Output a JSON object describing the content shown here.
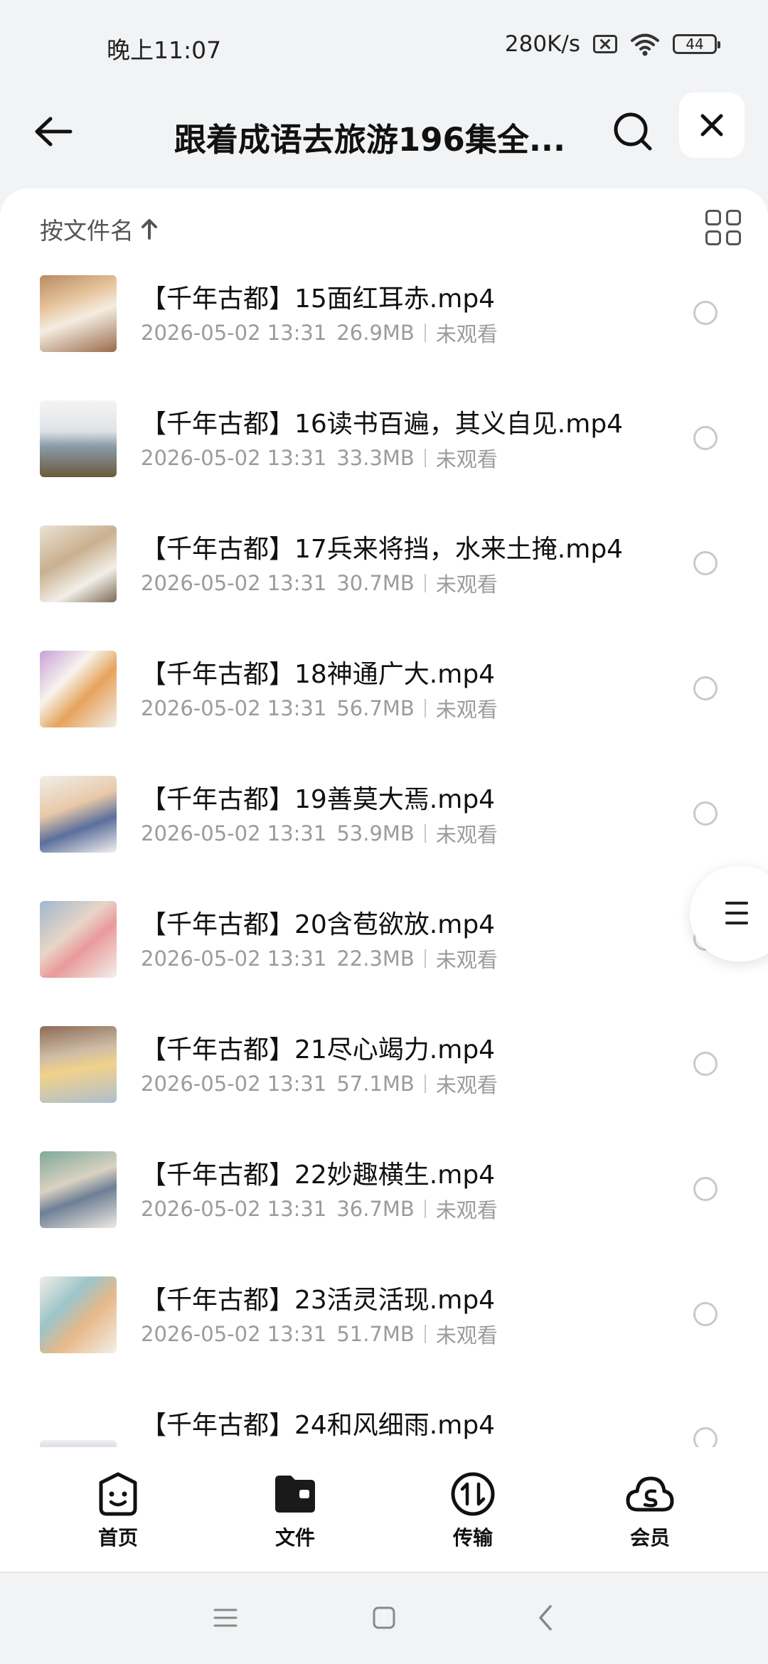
{
  "status_bar": {
    "time": "晚上11:07",
    "network_speed": "280K/s",
    "battery": "44"
  },
  "header": {
    "title": "跟着成语去旅游196集全..."
  },
  "sort": {
    "label": "按文件名"
  },
  "files": [
    {
      "name": "【千年古都】15面红耳赤.mp4",
      "date": "2026-05-02 13:31",
      "size": "26.9MB",
      "status": "未观看"
    },
    {
      "name": "【千年古都】16读书百遍，其义自见.mp4",
      "date": "2026-05-02 13:31",
      "size": "33.3MB",
      "status": "未观看"
    },
    {
      "name": "【千年古都】17兵来将挡，水来土掩.mp4",
      "date": "2026-05-02 13:31",
      "size": "30.7MB",
      "status": "未观看"
    },
    {
      "name": "【千年古都】18神通广大.mp4",
      "date": "2026-05-02 13:31",
      "size": "56.7MB",
      "status": "未观看"
    },
    {
      "name": "【千年古都】19善莫大焉.mp4",
      "date": "2026-05-02 13:31",
      "size": "53.9MB",
      "status": "未观看"
    },
    {
      "name": "【千年古都】20含苞欲放.mp4",
      "date": "2026-05-02 13:31",
      "size": "22.3MB",
      "status": "未观看"
    },
    {
      "name": "【千年古都】21尽心竭力.mp4",
      "date": "2026-05-02 13:31",
      "size": "57.1MB",
      "status": "未观看"
    },
    {
      "name": "【千年古都】22妙趣横生.mp4",
      "date": "2026-05-02 13:31",
      "size": "36.7MB",
      "status": "未观看"
    },
    {
      "name": "【千年古都】23活灵活现.mp4",
      "date": "2026-05-02 13:31",
      "size": "51.7MB",
      "status": "未观看"
    },
    {
      "name": "【千年古都】24和风细雨.mp4",
      "date": "",
      "size": "",
      "status": ""
    }
  ],
  "tabs": [
    {
      "label": "首页",
      "icon": "smile-face-icon"
    },
    {
      "label": "文件",
      "icon": "folder-icon"
    },
    {
      "label": "传输",
      "icon": "transfer-icon"
    },
    {
      "label": "会员",
      "icon": "cloud-icon"
    }
  ]
}
